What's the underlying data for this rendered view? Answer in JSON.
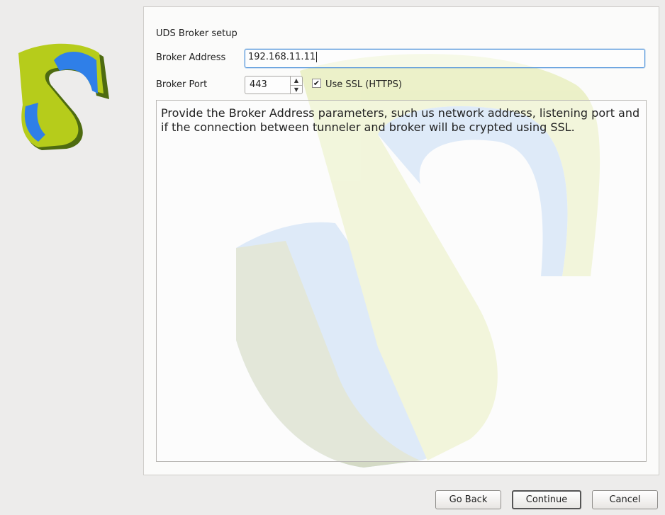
{
  "logo": {
    "icon": "uds-logo-icon",
    "colors": [
      "#b6cc1b",
      "#2f7fe8",
      "#4e6b10"
    ]
  },
  "form": {
    "title": "UDS Broker setup",
    "address_label": "Broker Address",
    "address_value": "192.168.11.11",
    "port_label": "Broker Port",
    "port_value": "443",
    "ssl_checked": true,
    "ssl_label": "Use SSL (HTTPS)",
    "description": "Provide the Broker Address parameters, such us network address, listening port and if the connection between tunneler and broker will be crypted using SSL."
  },
  "buttons": {
    "back": "Go Back",
    "continue": "Continue",
    "cancel": "Cancel"
  }
}
